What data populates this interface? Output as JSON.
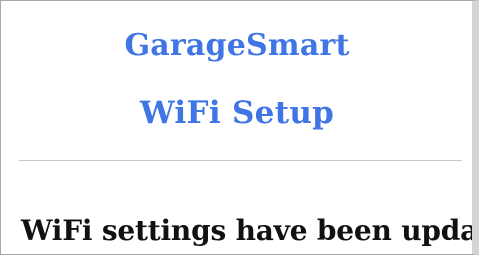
{
  "header": {
    "app_name": "GarageSmart",
    "page_title": "WiFi Setup"
  },
  "main": {
    "status_message": "WiFi settings have been updated"
  },
  "colors": {
    "heading": "#3f75e4",
    "text": "#111111",
    "divider": "#c8c8c8",
    "background": "#ffffff"
  }
}
